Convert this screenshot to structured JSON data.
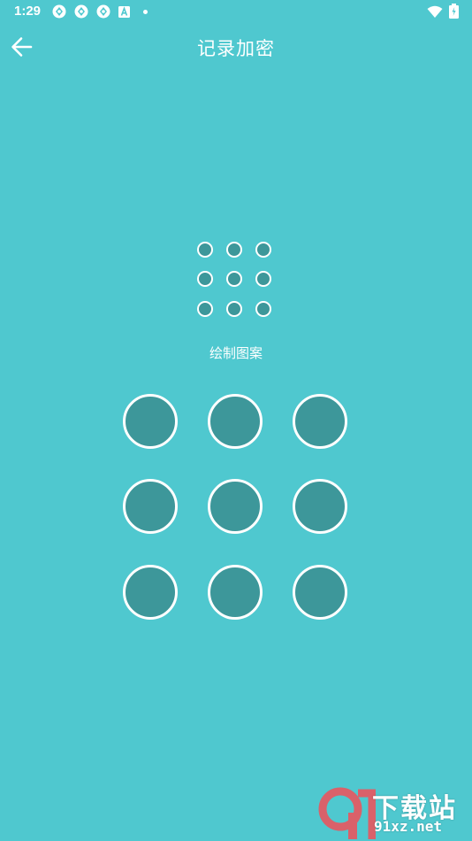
{
  "status_bar": {
    "time": "1:29",
    "notification_icons": [
      "app-notification-icon",
      "app-notification-icon",
      "app-notification-icon",
      "font-a-icon"
    ],
    "system_icons": [
      "wifi-icon",
      "battery-icon"
    ]
  },
  "app_bar": {
    "title": "记录加密",
    "back_icon": "arrow-left-icon"
  },
  "pattern_preview": {
    "rows": 3,
    "cols": 3
  },
  "hint": "绘制图案",
  "pattern_lock": {
    "rows": 3,
    "cols": 3
  },
  "colors": {
    "background": "#4fc8cf",
    "node_fill": "#3d979a",
    "node_border": "#ffffff"
  },
  "watermark": {
    "logo_text": "9",
    "text": "下载站",
    "url": "91xz.net"
  }
}
